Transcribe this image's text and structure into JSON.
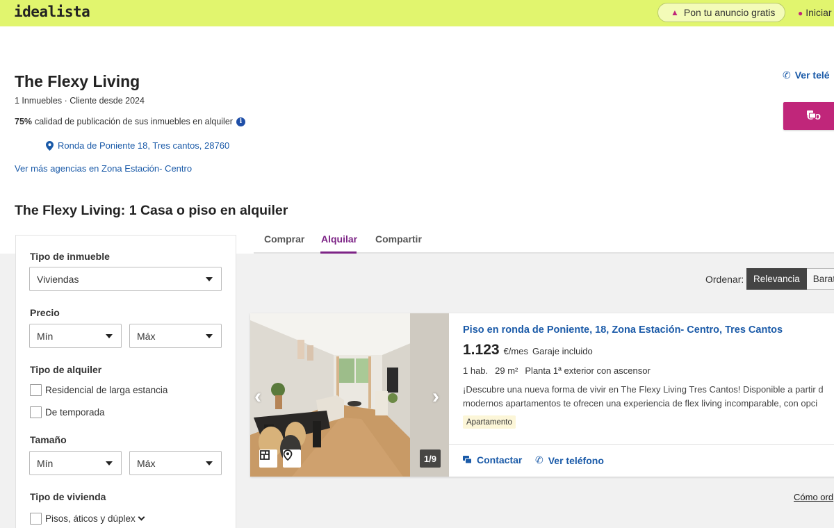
{
  "header": {
    "logo": "idealista",
    "publish_label": "Pon tu anuncio gratis",
    "login_label": "Iniciar"
  },
  "agency": {
    "name": "The Flexy Living",
    "meta": "1 Inmuebles · Cliente desde 2024",
    "quality_pct": "75%",
    "quality_text": "calidad de publicación de sus inmuebles en alquiler",
    "address": "Ronda de Poniente 18, Tres cantos, 28760",
    "more_agencies": "Ver más agencias en Zona Estación- Centro",
    "phone_label": "Ver telé",
    "contact_label": "Co"
  },
  "section_title": "The Flexy Living: 1 Casa o piso en alquiler",
  "filters": {
    "property_type_label": "Tipo de inmueble",
    "property_type_value": "Viviendas",
    "price_label": "Precio",
    "price_min": "Mín",
    "price_max": "Máx",
    "rental_type_label": "Tipo de alquiler",
    "rental_options": [
      "Residencial de larga estancia",
      "De temporada"
    ],
    "size_label": "Tamaño",
    "size_min": "Mín",
    "size_max": "Máx",
    "housing_type_label": "Tipo de vivienda",
    "housing_option": "Pisos, áticos y dúplex"
  },
  "tabs": [
    "Comprar",
    "Alquilar",
    "Compartir"
  ],
  "active_tab": "Alquilar",
  "sort": {
    "label": "Ordenar:",
    "options": [
      "Relevancia",
      "Barato"
    ],
    "active": "Relevancia"
  },
  "listing": {
    "title": "Piso en ronda de Poniente, 18, Zona Estación- Centro, Tres Cantos",
    "price": "1.123",
    "price_unit": "€/mes",
    "price_extra": "Garaje incluido",
    "details": [
      "1 hab.",
      "29 m²",
      "Planta 1ª exterior con ascensor"
    ],
    "description_line1": "¡Descubre una nueva forma de vivir en The Flexy Living Tres Cantos! Disponible a partir d",
    "description_line2": "modernos apartamentos te ofrecen una experiencia de flex living incomparable, con opci",
    "tag": "Apartamento",
    "photo_counter": "1/9",
    "contact_label": "Contactar",
    "phone_label": "Ver teléfono"
  },
  "footer_link": "Cómo ord",
  "colors": {
    "topbar": "#e1f56e",
    "brand_magenta": "#c0267a",
    "link_blue": "#1a5aa8",
    "tab_purple": "#7d2486"
  }
}
